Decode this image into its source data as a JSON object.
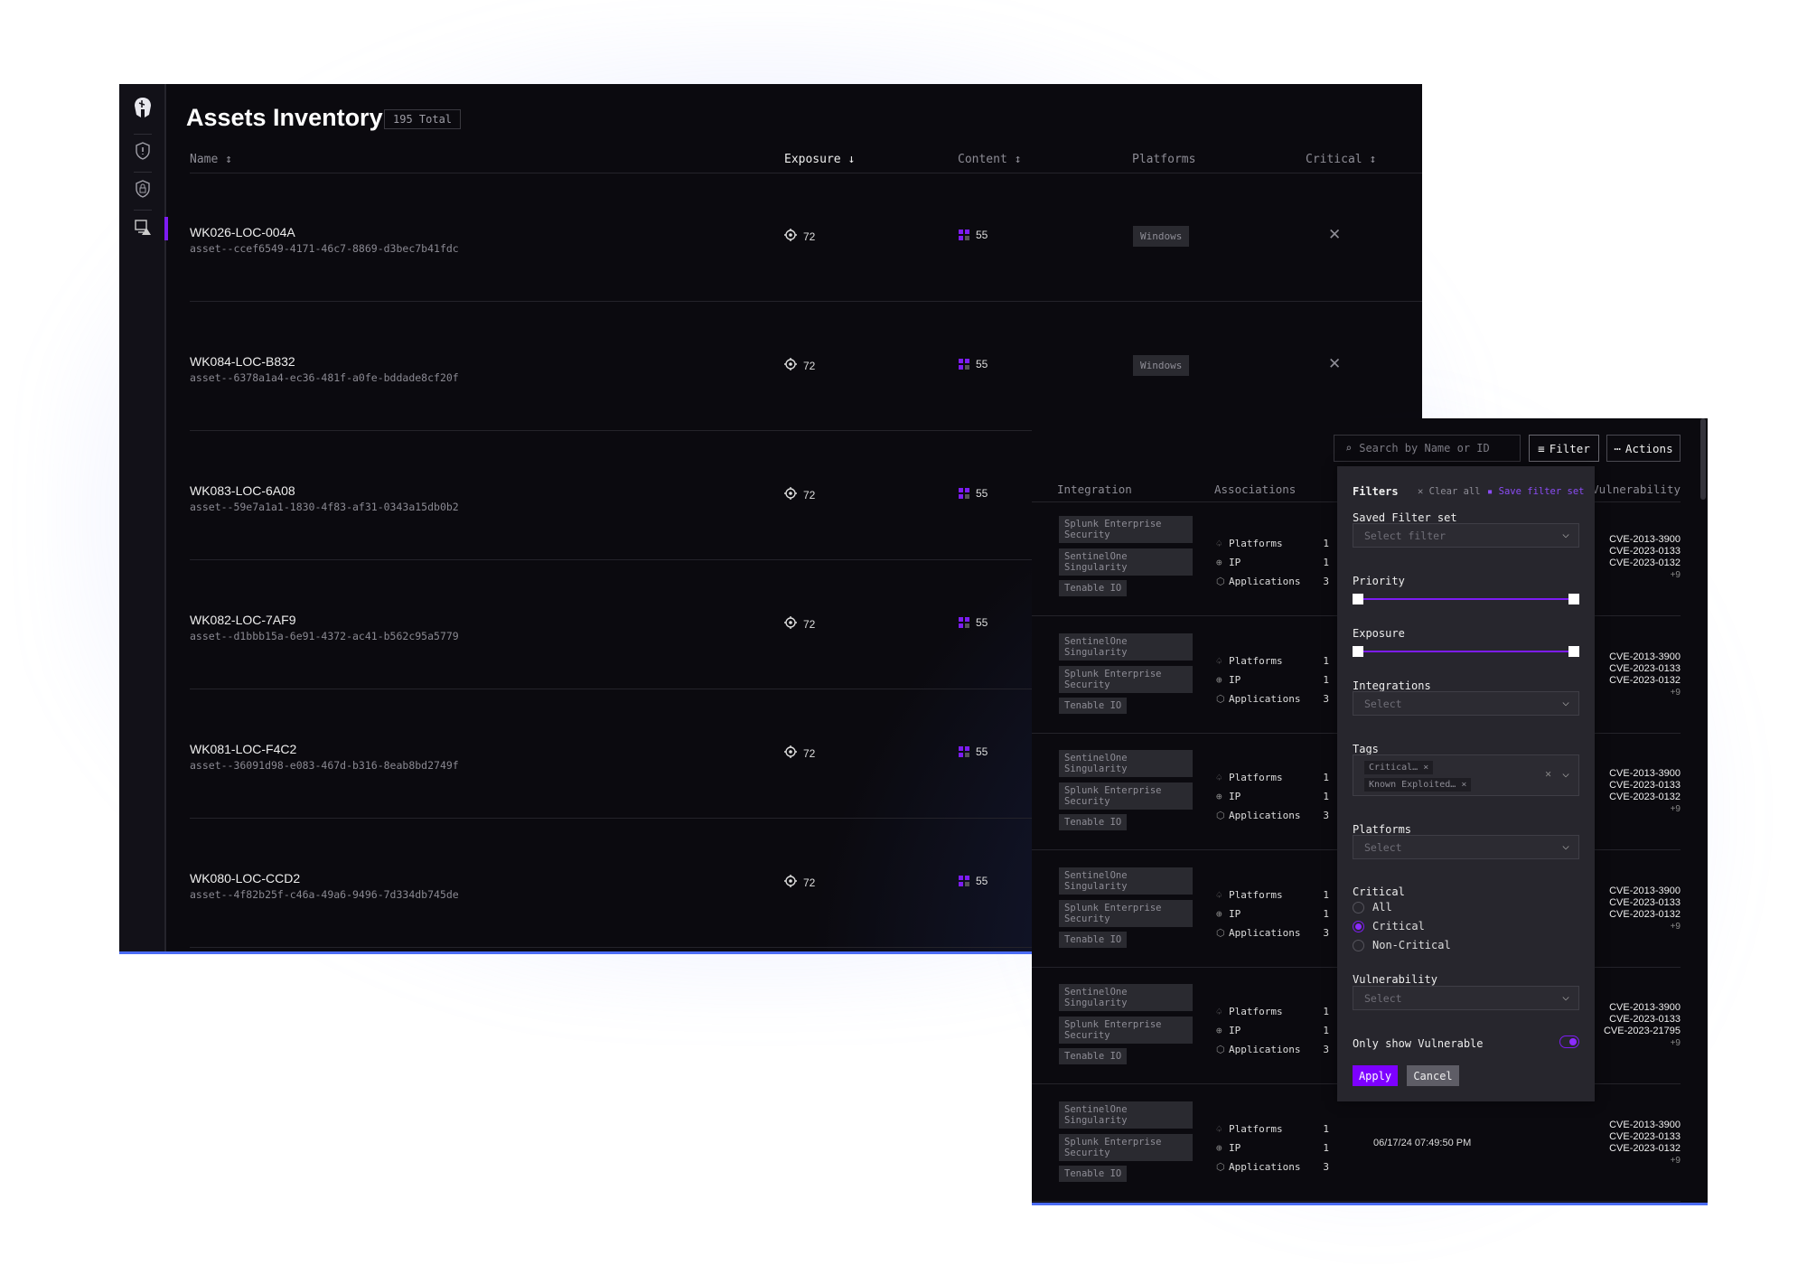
{
  "assets": {
    "title": "Assets Inventory",
    "total_badge": "195 Total",
    "sidebar": [
      {
        "icon": "logo-helmet-icon"
      },
      {
        "icon": "shield-alert-icon"
      },
      {
        "icon": "shield-lock-icon"
      },
      {
        "icon": "monitor-warning-icon",
        "active": true
      }
    ],
    "columns": {
      "name": "Name ↕",
      "exposure": "Exposure ↓",
      "content": "Content ↕",
      "platforms": "Platforms",
      "critical": "Critical ↕"
    },
    "rows": [
      {
        "name": "WK026-LOC-004A",
        "id": "asset--ccef6549-4171-46c7-8869-d3bec7b41fdc",
        "exposure": "72",
        "content": "55",
        "platform": "Windows",
        "critical": "✕"
      },
      {
        "name": "WK084-LOC-B832",
        "id": "asset--6378a1a4-ec36-481f-a0fe-bddade8cf20f",
        "exposure": "72",
        "content": "55",
        "platform": "Windows",
        "critical": "✕"
      },
      {
        "name": "WK083-LOC-6A08",
        "id": "asset--59e7a1a1-1830-4f83-af31-0343a15db0b2",
        "exposure": "72",
        "content": "55"
      },
      {
        "name": "WK082-LOC-7AF9",
        "id": "asset--d1bbb15a-6e91-4372-ac41-b562c95a5779",
        "exposure": "72",
        "content": "55"
      },
      {
        "name": "WK081-LOC-F4C2",
        "id": "asset--36091d98-e083-467d-b316-8eab8bd2749f",
        "exposure": "72",
        "content": "55"
      },
      {
        "name": "WK080-LOC-CCD2",
        "id": "asset--4f82b25f-c46a-49a6-9496-7d334db745de",
        "exposure": "72",
        "content": "55"
      }
    ]
  },
  "detail": {
    "search_placeholder": "Search by Name or ID",
    "filter_label": "Filter",
    "actions_label": "Actions",
    "columns": {
      "integration": "Integration",
      "associations": "Associations",
      "vulnerability": "Vulnerability"
    },
    "rows": [
      {
        "integrations": [
          "Splunk Enterprise Security",
          "SentinelOne Singularity",
          "Tenable IO"
        ],
        "assoc": [
          [
            "Platforms",
            "1"
          ],
          [
            "IP",
            "1"
          ],
          [
            "Applications",
            "3"
          ]
        ],
        "cves": [
          "CVE-2013-3900",
          "CVE-2023-0133",
          "CVE-2023-0132"
        ],
        "more": "+9"
      },
      {
        "integrations": [
          "SentinelOne Singularity",
          "Splunk Enterprise Security",
          "Tenable IO"
        ],
        "assoc": [
          [
            "Platforms",
            "1"
          ],
          [
            "IP",
            "1"
          ],
          [
            "Applications",
            "3"
          ]
        ],
        "cves": [
          "CVE-2013-3900",
          "CVE-2023-0133",
          "CVE-2023-0132"
        ],
        "more": "+9"
      },
      {
        "integrations": [
          "SentinelOne Singularity",
          "Splunk Enterprise Security",
          "Tenable IO"
        ],
        "assoc": [
          [
            "Platforms",
            "1"
          ],
          [
            "IP",
            "1"
          ],
          [
            "Applications",
            "3"
          ]
        ],
        "cves": [
          "CVE-2013-3900",
          "CVE-2023-0133",
          "CVE-2023-0132"
        ],
        "more": "+9"
      },
      {
        "integrations": [
          "SentinelOne Singularity",
          "Splunk Enterprise Security",
          "Tenable IO"
        ],
        "assoc": [
          [
            "Platforms",
            "1"
          ],
          [
            "IP",
            "1"
          ],
          [
            "Applications",
            "3"
          ]
        ],
        "cves": [
          "CVE-2013-3900",
          "CVE-2023-0133",
          "CVE-2023-0132"
        ],
        "more": "+9"
      },
      {
        "integrations": [
          "SentinelOne Singularity",
          "Splunk Enterprise Security",
          "Tenable IO"
        ],
        "assoc": [
          [
            "Platforms",
            "1"
          ],
          [
            "IP",
            "1"
          ],
          [
            "Applications",
            "3"
          ]
        ],
        "cves": [
          "CVE-2013-3900",
          "CVE-2023-0133",
          "CVE-2023-21795"
        ],
        "more": "+9"
      },
      {
        "integrations": [
          "SentinelOne Singularity",
          "Splunk Enterprise Security",
          "Tenable IO"
        ],
        "assoc": [
          [
            "Platforms",
            "1"
          ],
          [
            "IP",
            "1"
          ],
          [
            "Applications",
            "3"
          ]
        ],
        "timestamp": "06/17/24 07:49:50 PM",
        "cves": [
          "CVE-2013-3900",
          "CVE-2023-0133",
          "CVE-2023-0132"
        ],
        "more": "+9"
      }
    ]
  },
  "filters": {
    "title": "Filters",
    "clear_all": "Clear all",
    "save_set": "Save filter set",
    "saved_label": "Saved Filter set",
    "saved_placeholder": "Select filter",
    "priority_label": "Priority",
    "priority_range": [
      0,
      100
    ],
    "exposure_label": "Exposure",
    "exposure_range": [
      0,
      100
    ],
    "integrations_label": "Integrations",
    "integrations_placeholder": "Select",
    "tags_label": "Tags",
    "tags": [
      "Critical…",
      "Known Exploited…"
    ],
    "platforms_label": "Platforms",
    "platforms_placeholder": "Select",
    "critical_label": "Critical",
    "critical_options": [
      "All",
      "Critical",
      "Non-Critical"
    ],
    "critical_selected": "Critical",
    "vulnerability_label": "Vulnerability",
    "vulnerability_placeholder": "Select",
    "only_vulnerable_label": "Only show Vulnerable",
    "only_vulnerable": true,
    "apply": "Apply",
    "cancel": "Cancel"
  },
  "colors": {
    "accent": "#7d1cf2",
    "background": "#0b0a0f",
    "panel": "#27262d",
    "frame_border": "#4b6cf5"
  }
}
